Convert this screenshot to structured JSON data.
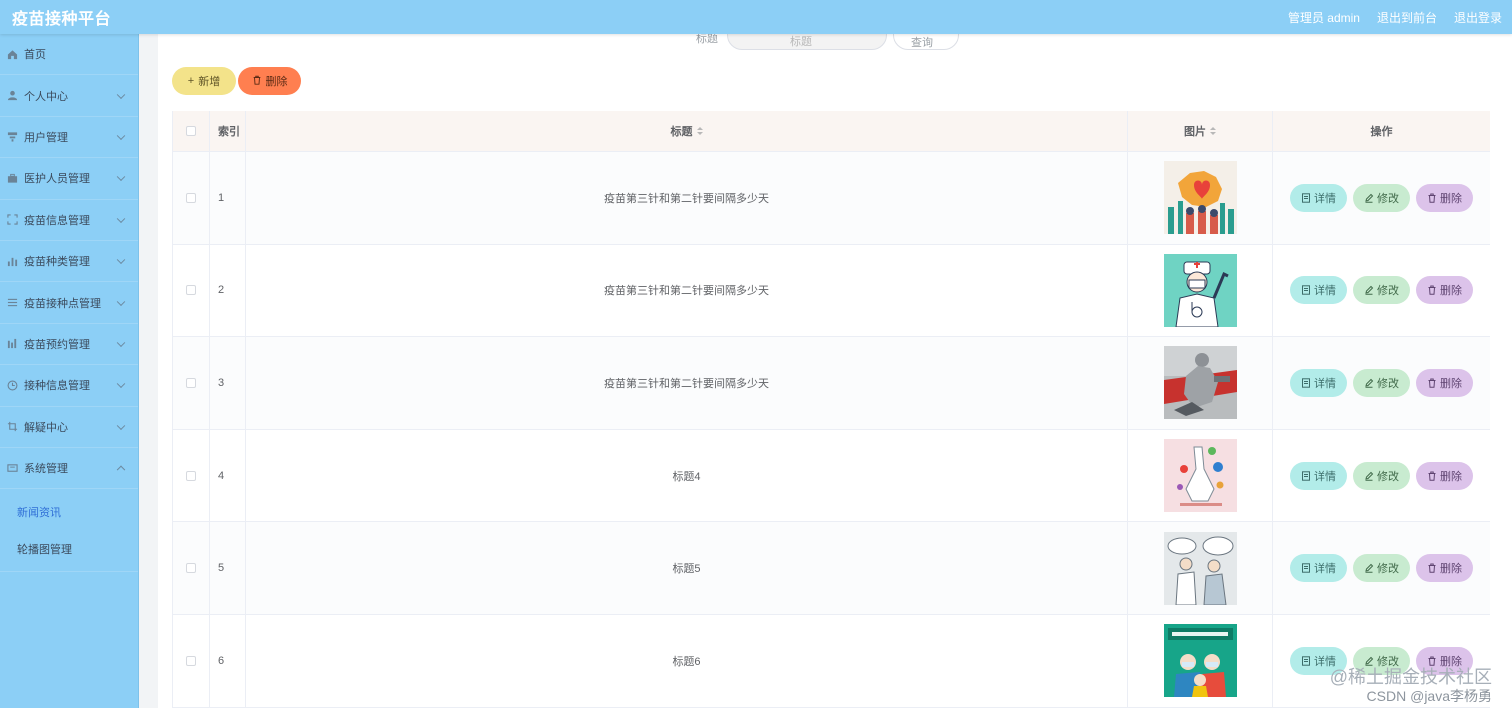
{
  "header": {
    "brand": "疫苗接种平台",
    "user": "管理员 admin",
    "to_front": "退出到前台",
    "logout": "退出登录"
  },
  "sidebar": {
    "items": [
      {
        "label": "首页",
        "icon": "home-icon"
      },
      {
        "label": "个人中心",
        "icon": "user-icon"
      },
      {
        "label": "用户管理",
        "icon": "users-icon"
      },
      {
        "label": "医护人员管理",
        "icon": "briefcase-icon"
      },
      {
        "label": "疫苗信息管理",
        "icon": "frame-icon"
      },
      {
        "label": "疫苗种类管理",
        "icon": "bar-chart-icon"
      },
      {
        "label": "疫苗接种点管理",
        "icon": "list-icon"
      },
      {
        "label": "疫苗预约管理",
        "icon": "column-chart-icon"
      },
      {
        "label": "接种信息管理",
        "icon": "clock-icon"
      },
      {
        "label": "解疑中心",
        "icon": "crop-icon"
      },
      {
        "label": "系统管理",
        "icon": "monitor-icon"
      }
    ],
    "sub_items": [
      {
        "label": "新闻资讯"
      },
      {
        "label": "轮播图管理"
      }
    ]
  },
  "search": {
    "label": "标题",
    "placeholder": "标题",
    "button": "查询"
  },
  "toolbar": {
    "add_label": "新增",
    "delete_label": "删除"
  },
  "table": {
    "columns": {
      "index": "索引",
      "title": "标题",
      "image": "图片",
      "ops": "操作"
    },
    "rows": [
      {
        "index": "1",
        "title": "疫苗第三针和第二针要间隔多少天",
        "image": "china-map-heart-illustration"
      },
      {
        "index": "2",
        "title": "疫苗第三针和第二针要间隔多少天",
        "image": "doctor-cartoon-illustration"
      },
      {
        "index": "3",
        "title": "疫苗第三针和第二针要间隔多少天",
        "image": "disinfection-worker-photo"
      },
      {
        "index": "4",
        "title": "标题4",
        "image": "virus-cleaning-illustration"
      },
      {
        "index": "5",
        "title": "标题5",
        "image": "doctor-patient-sketch"
      },
      {
        "index": "6",
        "title": "标题6",
        "image": "epidemic-prevention-handbook-cover"
      }
    ],
    "ops": {
      "detail": "详情",
      "edit": "修改",
      "delete": "删除"
    }
  },
  "colors": {
    "header_bg": "#8ccff6",
    "add_btn": "#f3e38a",
    "delete_btn": "#ff7f50",
    "detail_btn": "#b2ece9",
    "edit_btn": "#c8ebd0",
    "row_delete_btn": "#dcc3ea"
  },
  "watermark": {
    "line1": "@稀土掘金技术社区",
    "line2": "CSDN @java李杨勇"
  }
}
